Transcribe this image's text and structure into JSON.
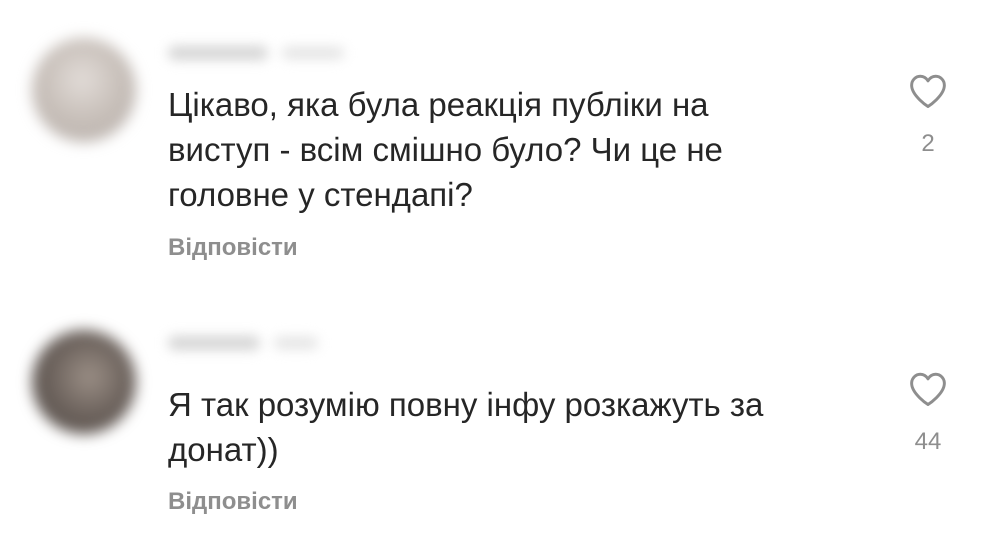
{
  "comments": [
    {
      "text": "Цікаво, яка була реакція публіки на\nвиступ - всім смішно було? Чи це не\nголовне у стендапі?",
      "reply_label": "Відповісти",
      "likes": "2",
      "like_icon": "heart-outline-icon"
    },
    {
      "text": "Я так розумію повну інфу розкажуть за\nдонат))",
      "reply_label": "Відповісти",
      "likes": "44",
      "like_icon": "heart-outline-icon"
    }
  ],
  "colors": {
    "text": "#262626",
    "secondary": "#8e8e8e",
    "background": "#ffffff"
  }
}
